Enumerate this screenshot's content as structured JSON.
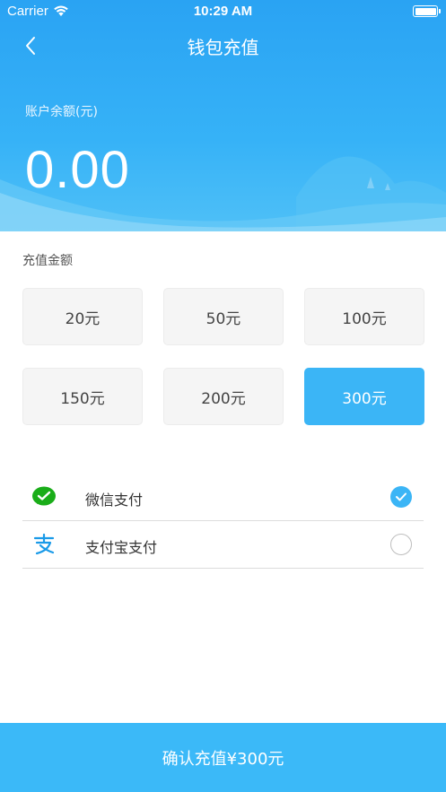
{
  "status_bar": {
    "carrier": "Carrier",
    "time": "10:29 AM"
  },
  "nav": {
    "title": "钱包充值",
    "back_icon": "chevron-left-icon"
  },
  "balance": {
    "label": "账户余额(元)",
    "value": "0.00"
  },
  "amount_section": {
    "title": "充值金额",
    "options": [
      "20元",
      "50元",
      "100元",
      "150元",
      "200元",
      "300元"
    ],
    "selected": "300元"
  },
  "payment": {
    "methods": [
      {
        "label": "微信支付",
        "icon": "wechat-pay-icon",
        "checked": true
      },
      {
        "label": "支付宝支付",
        "icon": "alipay-icon",
        "checked": false
      }
    ]
  },
  "confirm": {
    "label": "确认充值¥300元"
  },
  "colors": {
    "primary": "#3bb5f6",
    "header": "#2aa3f3",
    "wechat_green": "#1aad19",
    "alipay_blue": "#1a9ae8"
  }
}
